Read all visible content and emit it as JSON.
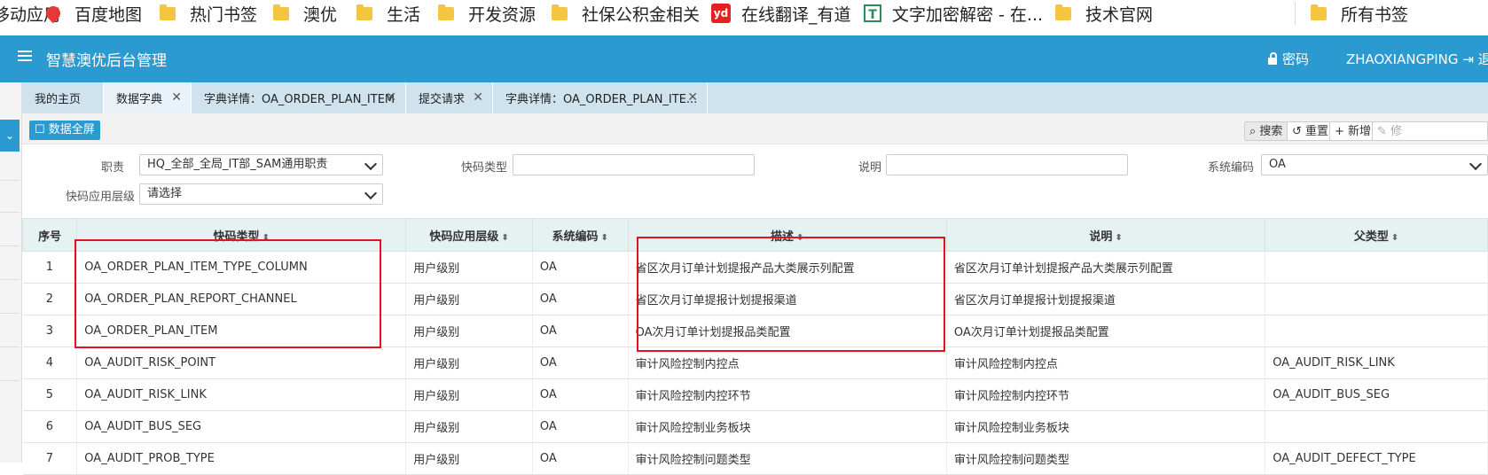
{
  "bookmarks": [
    {
      "label": "移动应用",
      "icon": "none"
    },
    {
      "label": "百度地图",
      "icon": "map-pin-icon"
    },
    {
      "label": "热门书签",
      "icon": "folder-icon"
    },
    {
      "label": "澳优",
      "icon": "folder-icon"
    },
    {
      "label": "生活",
      "icon": "folder-icon"
    },
    {
      "label": "开发资源",
      "icon": "folder-icon"
    },
    {
      "label": "社保公积金相关",
      "icon": "folder-icon"
    },
    {
      "label": "在线翻译_有道",
      "icon": "youdao-icon"
    },
    {
      "label": "文字加密解密 - 在...",
      "icon": "text-tool-icon"
    },
    {
      "label": "技术官网",
      "icon": "folder-icon"
    },
    {
      "label": "所有书签",
      "icon": "folder-icon"
    }
  ],
  "header": {
    "title": "智慧澳优后台管理",
    "password_label": "密码",
    "username": "ZHAOXIANGPING",
    "logout_label": "退"
  },
  "tabs": [
    {
      "label": "我的主页",
      "closable": false
    },
    {
      "label": "数据字典",
      "closable": true,
      "active": true
    },
    {
      "label": "字典详情：OA_ORDER_PLAN_ITEM",
      "closable": true
    },
    {
      "label": "提交请求",
      "closable": true
    },
    {
      "label": "字典详情：OA_ORDER_PLAN_ITE...",
      "closable": true
    }
  ],
  "toolbar": {
    "fullscreen_label": "数据全屏",
    "search_label": "搜索",
    "reset_label": "重置",
    "add_label": "新增",
    "edit_label": "修"
  },
  "filters": {
    "role_label": "职责",
    "role_value": "HQ_全部_全局_IT部_SAM通用职责",
    "code_type_label": "快码类型",
    "code_type_value": "",
    "desc_label": "说明",
    "desc_value": "",
    "sys_code_label": "系统编码",
    "sys_code_value": "OA",
    "level_label": "快码应用层级",
    "level_value": "请选择"
  },
  "table": {
    "columns": [
      "序号",
      "快码类型",
      "快码应用层级",
      "系统编码",
      "描述",
      "说明",
      "父类型"
    ],
    "rows": [
      [
        "1",
        "OA_ORDER_PLAN_ITEM_TYPE_COLUMN",
        "用户级别",
        "OA",
        "省区次月订单计划提报产品大类展示列配置",
        "省区次月订单计划提报产品大类展示列配置",
        ""
      ],
      [
        "2",
        "OA_ORDER_PLAN_REPORT_CHANNEL",
        "用户级别",
        "OA",
        "省区次月订单提报计划提报渠道",
        "省区次月订单提报计划提报渠道",
        ""
      ],
      [
        "3",
        "OA_ORDER_PLAN_ITEM",
        "用户级别",
        "OA",
        "OA次月订单计划提报品类配置",
        "OA次月订单计划提报品类配置",
        ""
      ],
      [
        "4",
        "OA_AUDIT_RISK_POINT",
        "用户级别",
        "OA",
        "审计风险控制内控点",
        "审计风险控制内控点",
        "OA_AUDIT_RISK_LINK"
      ],
      [
        "5",
        "OA_AUDIT_RISK_LINK",
        "用户级别",
        "OA",
        "审计风险控制内控环节",
        "审计风险控制内控环节",
        "OA_AUDIT_BUS_SEG"
      ],
      [
        "6",
        "OA_AUDIT_BUS_SEG",
        "用户级别",
        "OA",
        "审计风险控制业务板块",
        "审计风险控制业务板块",
        ""
      ],
      [
        "7",
        "OA_AUDIT_PROB_TYPE",
        "用户级别",
        "OA",
        "审计风险控制问题类型",
        "审计风险控制问题类型",
        "OA_AUDIT_DEFECT_TYPE"
      ]
    ]
  }
}
